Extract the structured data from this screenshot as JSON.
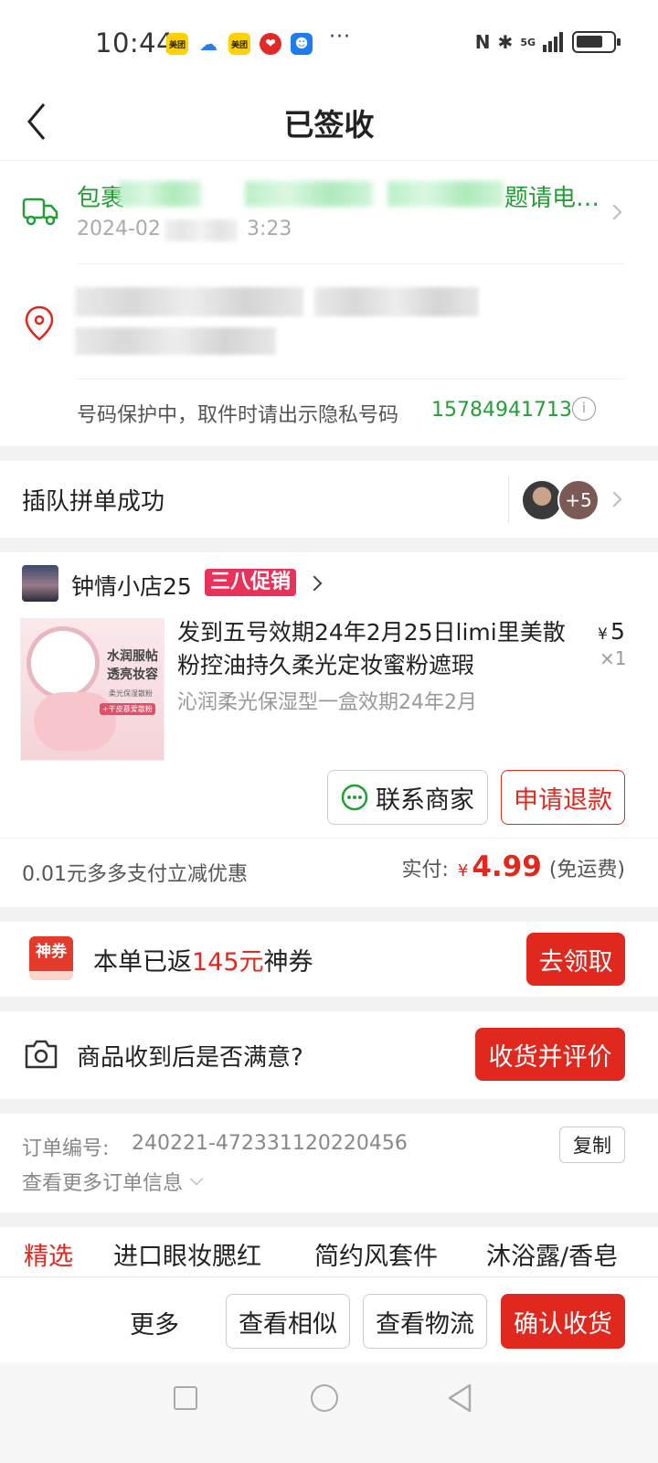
{
  "status_bar": {
    "time": "10:44",
    "app_icons": [
      {
        "name": "meituan-icon",
        "text": "美团",
        "bg": "#ffd100",
        "fg": "#222"
      },
      {
        "name": "cloud-chat-icon",
        "text": "",
        "bg": "#ffffff",
        "fg": "#2a7de1"
      },
      {
        "name": "meituan-icon-2",
        "text": "美团",
        "bg": "#ffd100",
        "fg": "#222"
      },
      {
        "name": "heart-app-icon",
        "text": "",
        "bg": "#e02a2a",
        "fg": "#fff"
      },
      {
        "name": "bot-app-icon",
        "text": "",
        "bg": "#1e7bf0",
        "fg": "#fff"
      }
    ],
    "more": "···",
    "network": "5G"
  },
  "nav": {
    "title": "已签收"
  },
  "logistics": {
    "status_prefix": "包裹",
    "status_suffix": "题请电…",
    "date_prefix": "2024-02",
    "date_suffix": "3:23"
  },
  "address": {
    "privacy_text": "号码保护中，取件时请出示隐私号码",
    "privacy_number": "15784941713"
  },
  "group": {
    "label": "插队拼单成功",
    "badge": "+5"
  },
  "shop": {
    "name": "钟情小店25",
    "promo": "三八促销",
    "product": {
      "title": "发到五号效期24年2月25日limi里美散粉控油持久柔光定妆蜜粉遮瑕",
      "spec": "沁润柔光保湿型一盒效期24年2月",
      "price_symbol": "¥",
      "price": "5",
      "qty": "×1",
      "image_text1": "水润服帖",
      "image_text2": "透亮妆容",
      "image_text3": "柔光保湿散粉",
      "image_text4": "+干皮慕爱散粉"
    },
    "contact_btn": "联系商家",
    "refund_btn": "申请退款",
    "discount_text": "0.01元多多支付立减优惠",
    "paid_label": "实付:",
    "paid_symbol": "¥",
    "paid_amount": "4.99",
    "paid_note": "(免运费)"
  },
  "coupon": {
    "icon_text": "神券",
    "text_prefix": "本单已返",
    "amount": "145元",
    "text_suffix": "神券",
    "btn": "去领取"
  },
  "review": {
    "question": "商品收到后是否满意?",
    "btn": "收货并评价"
  },
  "order": {
    "number_label": "订单编号:",
    "number": "240221-472331120220456",
    "copy_btn": "复制",
    "more": "查看更多订单信息"
  },
  "tabs": [
    "精选",
    "进口眼妆腮红",
    "简约风套件",
    "沐浴露/香皂"
  ],
  "bottom_bar": {
    "more": "更多",
    "similar": "查看相似",
    "logistics": "查看物流",
    "confirm": "确认收货"
  },
  "colors": {
    "accent": "#e0281e",
    "green": "#22a035"
  }
}
